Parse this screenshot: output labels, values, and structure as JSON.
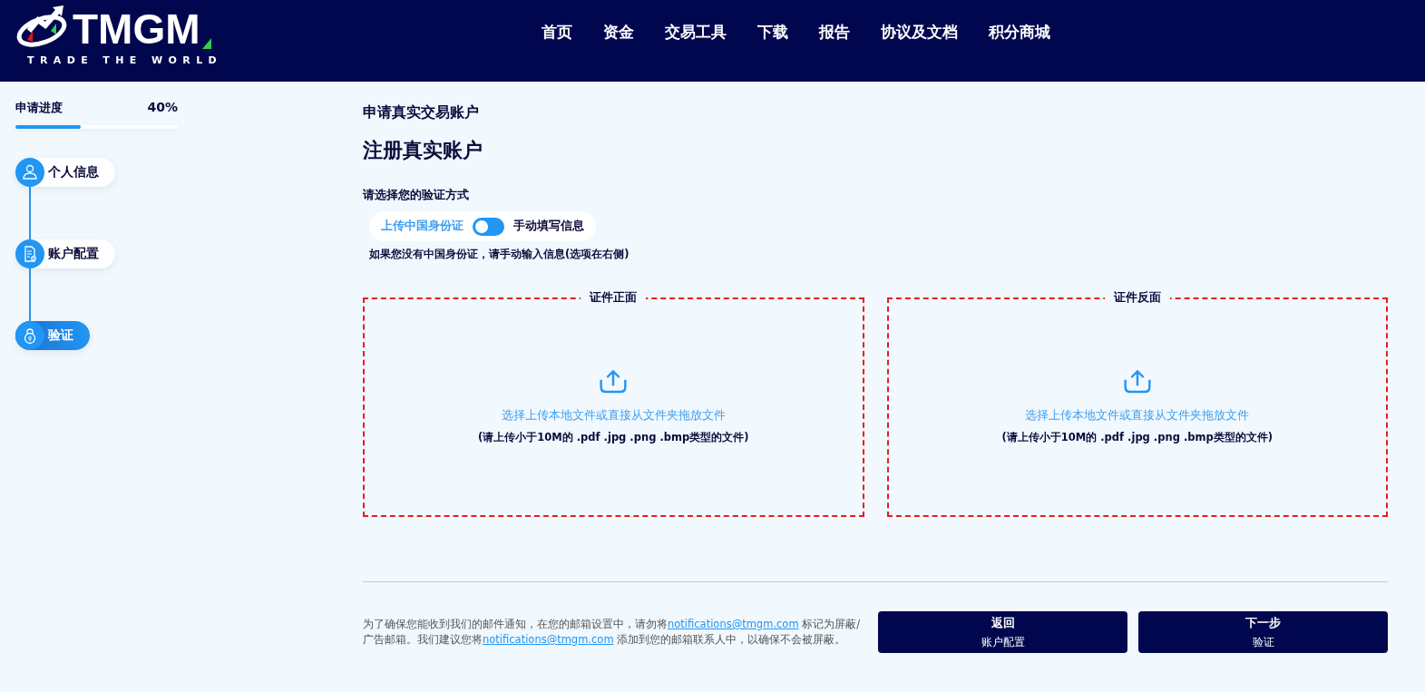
{
  "header": {
    "logo": {
      "wordmark": "TMGM",
      "tagline": "TRADE THE WORLD"
    },
    "nav": [
      "首页",
      "资金",
      "交易工具",
      "下载",
      "报告",
      "协议及文档",
      "积分商城"
    ]
  },
  "progress": {
    "label": "申请进度",
    "reading": "40%",
    "level": 0.4
  },
  "steps": [
    {
      "label": "个人信息",
      "selected": false
    },
    {
      "label": "账户配置",
      "selected": false
    },
    {
      "label": "验证",
      "selected": true
    }
  ],
  "breadcrumb": "申请真实交易账户",
  "title": "注册真实账户",
  "verification": {
    "prompt": "请选择您的验证方式",
    "option_left": "上传中国身份证",
    "option_right": "手动填写信息",
    "on": false,
    "hint": "如果您没有中国身份证，请手动输入信息(选项在右侧)"
  },
  "uploads": [
    {
      "legend": "证件正面",
      "action": "选择上传本地文件或直接从文件夹拖放文件",
      "note": "(请上传小于10M的 .pdf .jpg .png .bmp类型的文件)"
    },
    {
      "legend": "证件反面",
      "action": "选择上传本地文件或直接从文件夹拖放文件",
      "note": "(请上传小于10M的 .pdf .jpg .png .bmp类型的文件)"
    }
  ],
  "notice": [
    {
      "kind": "text",
      "text": "为了确保您能收到我们的邮件通知，在您的邮箱设置中，请勿将"
    },
    {
      "kind": "link",
      "text": "notifications@tmgm.com"
    },
    {
      "kind": "text",
      "text": " 标记为屏蔽/广告邮箱。我们建议您将"
    },
    {
      "kind": "link",
      "text": "notifications@tmgm.com"
    },
    {
      "kind": "text",
      "text": " 添加到您的邮箱联系人中，以确保不会被屏蔽。"
    }
  ],
  "buttons": [
    {
      "label": "返回",
      "sublabel": "账户配置"
    },
    {
      "label": "下一步",
      "sublabel": "验证"
    }
  ]
}
